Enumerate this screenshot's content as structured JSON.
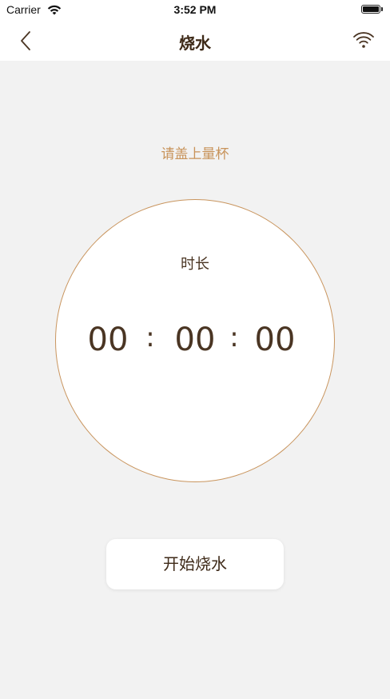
{
  "status_bar": {
    "carrier": "Carrier",
    "time": "3:52 PM"
  },
  "nav": {
    "title": "烧水",
    "back_icon": "chevron-left-icon",
    "wifi_icon": "wifi-icon"
  },
  "hint": "请盖上量杯",
  "timer": {
    "label": "时长",
    "hours": "00",
    "minutes": "00",
    "seconds": "00",
    "separator": ":"
  },
  "start_button": "开始烧水",
  "colors": {
    "accent": "#c8935a",
    "text_dark": "#4a3523",
    "background": "#f2f2f2",
    "circle_border": "#c9955e"
  }
}
